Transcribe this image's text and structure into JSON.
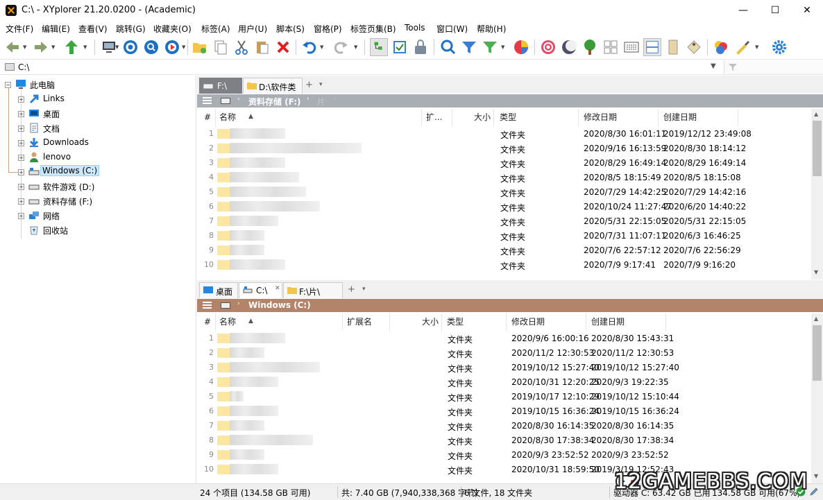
{
  "window": {
    "title": "C:\\ - XYplorer 21.20.0200 - (Academic)",
    "minimize": "—",
    "maximize": "☐",
    "close": "✕"
  },
  "menu": [
    "文件(F)",
    "编辑(E)",
    "查看(V)",
    "跳转(G)",
    "收藏夹(O)",
    "标签(A)",
    "用户(U)",
    "脚本(S)",
    "窗格(P)",
    "标签页集(B)",
    "Tools",
    "窗口(W)",
    "帮助(H)"
  ],
  "address": {
    "path": "C:\\"
  },
  "tree": [
    {
      "label": "此电脑",
      "icon": "computer-icon"
    },
    {
      "label": "Links",
      "icon": "link-icon"
    },
    {
      "label": "桌面",
      "icon": "desktop-icon"
    },
    {
      "label": "文档",
      "icon": "document-icon"
    },
    {
      "label": "Downloads",
      "icon": "download-icon"
    },
    {
      "label": "lenovo",
      "icon": "user-icon"
    },
    {
      "label": "Windows (C:)",
      "icon": "drive-icon"
    },
    {
      "label": "软件游戏 (D:)",
      "icon": "drive-icon"
    },
    {
      "label": "资料存储 (F:)",
      "icon": "drive-icon"
    },
    {
      "label": "网络",
      "icon": "network-icon"
    },
    {
      "label": "回收站",
      "icon": "recycle-bin-icon"
    }
  ],
  "pane1": {
    "tabs": [
      "F:\\",
      "D:\\软件类"
    ],
    "tab_add": "+",
    "tab_more": "▾",
    "breadcrumb": [
      "资料存储 (F:)",
      "片"
    ],
    "breadcrumb_sep": "›",
    "columns": {
      "num": "#",
      "name": "名称",
      "ext": "扩...",
      "size": "大小",
      "type": "类型",
      "modified": "修改日期",
      "created": "创建日期"
    },
    "rows": [
      {
        "num": "1",
        "type": "文件夹",
        "modified": "2020/8/30 16:01:11",
        "created": "2019/12/12 23:49:08"
      },
      {
        "num": "2",
        "type": "文件夹",
        "modified": "2020/9/16 16:13:59",
        "created": "2020/8/30 18:14:12"
      },
      {
        "num": "3",
        "type": "文件夹",
        "modified": "2020/8/29 16:49:14",
        "created": "2020/8/29 16:49:14"
      },
      {
        "num": "4",
        "type": "文件夹",
        "modified": "2020/8/5 18:15:49",
        "created": "2020/8/5 18:15:08"
      },
      {
        "num": "5",
        "type": "文件夹",
        "modified": "2020/7/29 14:42:25",
        "created": "2020/7/29 14:42:16"
      },
      {
        "num": "6",
        "type": "文件夹",
        "modified": "2020/10/24 11:27:47",
        "created": "2020/6/20 14:40:22"
      },
      {
        "num": "7",
        "type": "文件夹",
        "modified": "2020/5/31 22:15:05",
        "created": "2020/5/31 22:15:05"
      },
      {
        "num": "8",
        "type": "文件夹",
        "modified": "2020/7/31 11:07:11",
        "created": "2020/6/3 16:46:25"
      },
      {
        "num": "9",
        "type": "文件夹",
        "modified": "2020/7/6 22:57:12",
        "created": "2020/7/6 22:56:29"
      },
      {
        "num": "10",
        "type": "文件夹",
        "modified": "2020/7/9 9:17:41",
        "created": "2020/7/9 9:16:20"
      }
    ]
  },
  "pane2": {
    "tabs": [
      "桌面",
      "C:\\",
      "F:\\片\\"
    ],
    "tab_close": "✕",
    "tab_add": "+",
    "tab_more": "▾",
    "breadcrumb": [
      "Windows (C:)"
    ],
    "breadcrumb_sep": "›",
    "columns": {
      "num": "#",
      "name": "名称",
      "ext": "扩展名",
      "size": "大小",
      "type": "类型",
      "modified": "修改日期",
      "created": "创建日期"
    },
    "rows": [
      {
        "num": "1",
        "type": "文件夹",
        "modified": "2020/9/6 16:00:16",
        "created": "2020/8/30 15:43:31"
      },
      {
        "num": "2",
        "type": "文件夹",
        "modified": "2020/11/2 12:30:53",
        "created": "2020/11/2 12:30:53"
      },
      {
        "num": "3",
        "type": "文件夹",
        "modified": "2019/10/12 15:27:40",
        "created": "2019/10/12 15:27:40"
      },
      {
        "num": "4",
        "type": "文件夹",
        "modified": "2020/10/31 12:20:25",
        "created": "2020/9/3 19:22:35"
      },
      {
        "num": "5",
        "type": "文件夹",
        "modified": "2019/10/17 12:10:29",
        "created": "2019/10/12 15:10:44"
      },
      {
        "num": "6",
        "type": "文件夹",
        "modified": "2019/10/15 16:36:24",
        "created": "2019/10/15 16:36:24"
      },
      {
        "num": "7",
        "type": "文件夹",
        "modified": "2020/8/30 16:14:35",
        "created": "2020/8/30 16:14:35"
      },
      {
        "num": "8",
        "type": "文件夹",
        "modified": "2020/8/30 17:38:34",
        "created": "2020/8/30 17:38:34"
      },
      {
        "num": "9",
        "type": "文件夹",
        "modified": "2020/9/3 23:52:52",
        "created": "2020/9/3 23:52:52"
      },
      {
        "num": "10",
        "type": "文件夹",
        "modified": "2020/10/31 18:59:50",
        "created": "2019/3/19 12:52:43"
      }
    ]
  },
  "status": {
    "items": "24 个项目 (134.58 GB 可用)",
    "total": "共: 7.40 GB (7,940,338,368 字节)",
    "counts": "6 文件, 18 文件夹",
    "drive": "驱动器 C: 63.42 GB 已用",
    "free": "134.58 GB 可用(67%)"
  },
  "watermark": "12GAMEBBS.COM",
  "colors": {
    "pane1_bar": "#a9aeb4",
    "pane2_bar": "#b4846a",
    "tree_line": "#c9a07e",
    "selection": "#cce8ff"
  }
}
